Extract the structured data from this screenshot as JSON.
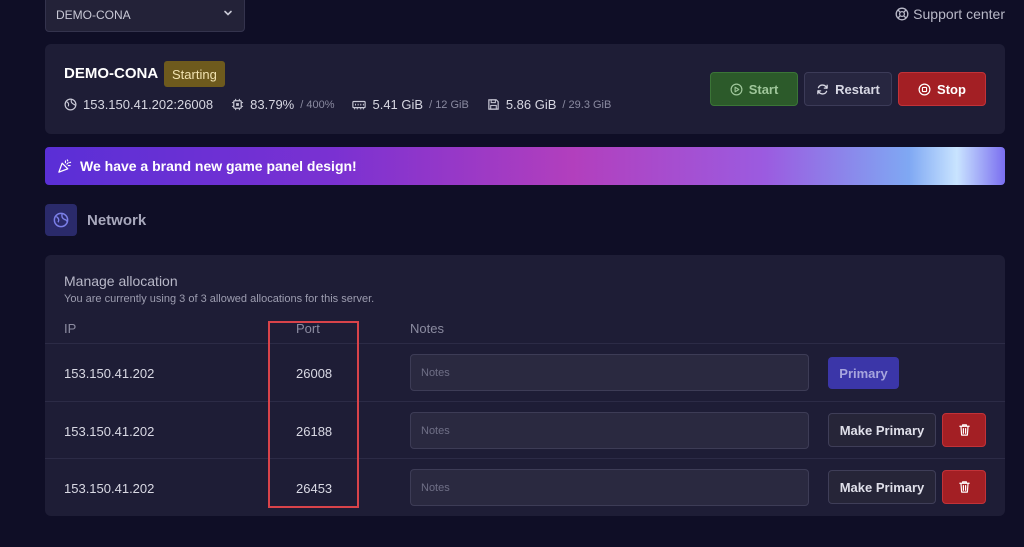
{
  "topbar": {
    "server_select_value": "DEMO-CONA",
    "support_label": "Support center"
  },
  "server": {
    "name": "DEMO-CONA",
    "status": "Starting",
    "address": "153.150.41.202:26008",
    "cpu_used": "83.79%",
    "cpu_limit": "/ 400%",
    "memory_used": "5.41 GiB",
    "memory_limit": "/ 12 GiB",
    "disk_used": "5.86 GiB",
    "disk_limit": "/ 29.3 GiB",
    "start_label": "Start",
    "restart_label": "Restart",
    "stop_label": "Stop"
  },
  "banner": {
    "text": "We have a brand new game panel design!"
  },
  "section": {
    "title": "Network"
  },
  "allocations": {
    "title": "Manage allocation",
    "subtitle": "You are currently using 3 of 3 allowed allocations for this server.",
    "headers": {
      "ip": "IP",
      "port": "Port",
      "notes": "Notes"
    },
    "notes_placeholder": "Notes",
    "primary_label": "Primary",
    "make_primary_label": "Make Primary",
    "rows": [
      {
        "ip": "153.150.41.202",
        "port": "26008",
        "notes": "",
        "is_primary": true
      },
      {
        "ip": "153.150.41.202",
        "port": "26188",
        "notes": "",
        "is_primary": false
      },
      {
        "ip": "153.150.41.202",
        "port": "26453",
        "notes": "",
        "is_primary": false
      }
    ]
  },
  "colors": {
    "background": "#0f0e26",
    "card": "#1e1d36",
    "start": "#2c5a2a",
    "stop": "#a31f24",
    "status_starting": "#6e5a1d",
    "primary": "#3b36a8",
    "highlight": "#d9434a"
  },
  "icons": {
    "dropdown": "chevron-down-icon",
    "support": "lifebuoy-icon",
    "address": "globe-icon",
    "cpu": "cpu-icon",
    "memory": "memory-icon",
    "disk": "disk-icon",
    "start": "play-icon",
    "restart": "refresh-icon",
    "stop": "stop-icon",
    "banner": "party-popper-icon",
    "network": "globe-icon",
    "delete": "trash-icon"
  }
}
